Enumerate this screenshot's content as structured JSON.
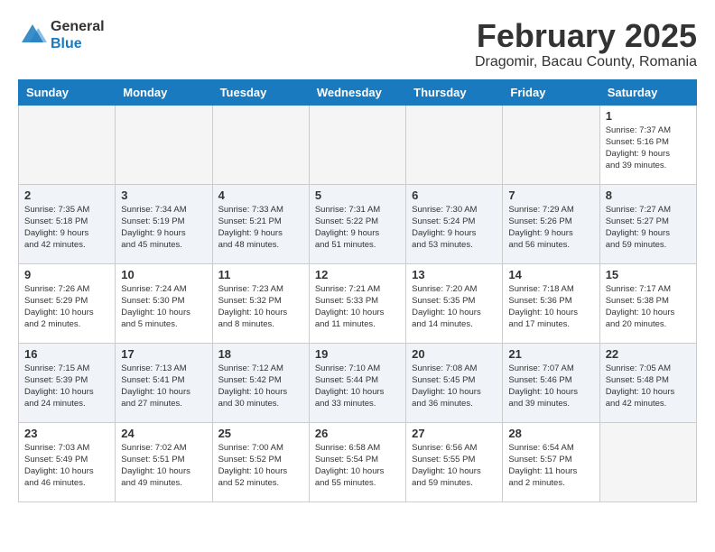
{
  "header": {
    "logo": {
      "general": "General",
      "blue": "Blue"
    },
    "title": "February 2025",
    "location": "Dragomir, Bacau County, Romania"
  },
  "columns": [
    "Sunday",
    "Monday",
    "Tuesday",
    "Wednesday",
    "Thursday",
    "Friday",
    "Saturday"
  ],
  "weeks": [
    [
      {
        "day": "",
        "info": ""
      },
      {
        "day": "",
        "info": ""
      },
      {
        "day": "",
        "info": ""
      },
      {
        "day": "",
        "info": ""
      },
      {
        "day": "",
        "info": ""
      },
      {
        "day": "",
        "info": ""
      },
      {
        "day": "1",
        "info": "Sunrise: 7:37 AM\nSunset: 5:16 PM\nDaylight: 9 hours\nand 39 minutes."
      }
    ],
    [
      {
        "day": "2",
        "info": "Sunrise: 7:35 AM\nSunset: 5:18 PM\nDaylight: 9 hours\nand 42 minutes."
      },
      {
        "day": "3",
        "info": "Sunrise: 7:34 AM\nSunset: 5:19 PM\nDaylight: 9 hours\nand 45 minutes."
      },
      {
        "day": "4",
        "info": "Sunrise: 7:33 AM\nSunset: 5:21 PM\nDaylight: 9 hours\nand 48 minutes."
      },
      {
        "day": "5",
        "info": "Sunrise: 7:31 AM\nSunset: 5:22 PM\nDaylight: 9 hours\nand 51 minutes."
      },
      {
        "day": "6",
        "info": "Sunrise: 7:30 AM\nSunset: 5:24 PM\nDaylight: 9 hours\nand 53 minutes."
      },
      {
        "day": "7",
        "info": "Sunrise: 7:29 AM\nSunset: 5:26 PM\nDaylight: 9 hours\nand 56 minutes."
      },
      {
        "day": "8",
        "info": "Sunrise: 7:27 AM\nSunset: 5:27 PM\nDaylight: 9 hours\nand 59 minutes."
      }
    ],
    [
      {
        "day": "9",
        "info": "Sunrise: 7:26 AM\nSunset: 5:29 PM\nDaylight: 10 hours\nand 2 minutes."
      },
      {
        "day": "10",
        "info": "Sunrise: 7:24 AM\nSunset: 5:30 PM\nDaylight: 10 hours\nand 5 minutes."
      },
      {
        "day": "11",
        "info": "Sunrise: 7:23 AM\nSunset: 5:32 PM\nDaylight: 10 hours\nand 8 minutes."
      },
      {
        "day": "12",
        "info": "Sunrise: 7:21 AM\nSunset: 5:33 PM\nDaylight: 10 hours\nand 11 minutes."
      },
      {
        "day": "13",
        "info": "Sunrise: 7:20 AM\nSunset: 5:35 PM\nDaylight: 10 hours\nand 14 minutes."
      },
      {
        "day": "14",
        "info": "Sunrise: 7:18 AM\nSunset: 5:36 PM\nDaylight: 10 hours\nand 17 minutes."
      },
      {
        "day": "15",
        "info": "Sunrise: 7:17 AM\nSunset: 5:38 PM\nDaylight: 10 hours\nand 20 minutes."
      }
    ],
    [
      {
        "day": "16",
        "info": "Sunrise: 7:15 AM\nSunset: 5:39 PM\nDaylight: 10 hours\nand 24 minutes."
      },
      {
        "day": "17",
        "info": "Sunrise: 7:13 AM\nSunset: 5:41 PM\nDaylight: 10 hours\nand 27 minutes."
      },
      {
        "day": "18",
        "info": "Sunrise: 7:12 AM\nSunset: 5:42 PM\nDaylight: 10 hours\nand 30 minutes."
      },
      {
        "day": "19",
        "info": "Sunrise: 7:10 AM\nSunset: 5:44 PM\nDaylight: 10 hours\nand 33 minutes."
      },
      {
        "day": "20",
        "info": "Sunrise: 7:08 AM\nSunset: 5:45 PM\nDaylight: 10 hours\nand 36 minutes."
      },
      {
        "day": "21",
        "info": "Sunrise: 7:07 AM\nSunset: 5:46 PM\nDaylight: 10 hours\nand 39 minutes."
      },
      {
        "day": "22",
        "info": "Sunrise: 7:05 AM\nSunset: 5:48 PM\nDaylight: 10 hours\nand 42 minutes."
      }
    ],
    [
      {
        "day": "23",
        "info": "Sunrise: 7:03 AM\nSunset: 5:49 PM\nDaylight: 10 hours\nand 46 minutes."
      },
      {
        "day": "24",
        "info": "Sunrise: 7:02 AM\nSunset: 5:51 PM\nDaylight: 10 hours\nand 49 minutes."
      },
      {
        "day": "25",
        "info": "Sunrise: 7:00 AM\nSunset: 5:52 PM\nDaylight: 10 hours\nand 52 minutes."
      },
      {
        "day": "26",
        "info": "Sunrise: 6:58 AM\nSunset: 5:54 PM\nDaylight: 10 hours\nand 55 minutes."
      },
      {
        "day": "27",
        "info": "Sunrise: 6:56 AM\nSunset: 5:55 PM\nDaylight: 10 hours\nand 59 minutes."
      },
      {
        "day": "28",
        "info": "Sunrise: 6:54 AM\nSunset: 5:57 PM\nDaylight: 11 hours\nand 2 minutes."
      },
      {
        "day": "",
        "info": ""
      }
    ]
  ]
}
